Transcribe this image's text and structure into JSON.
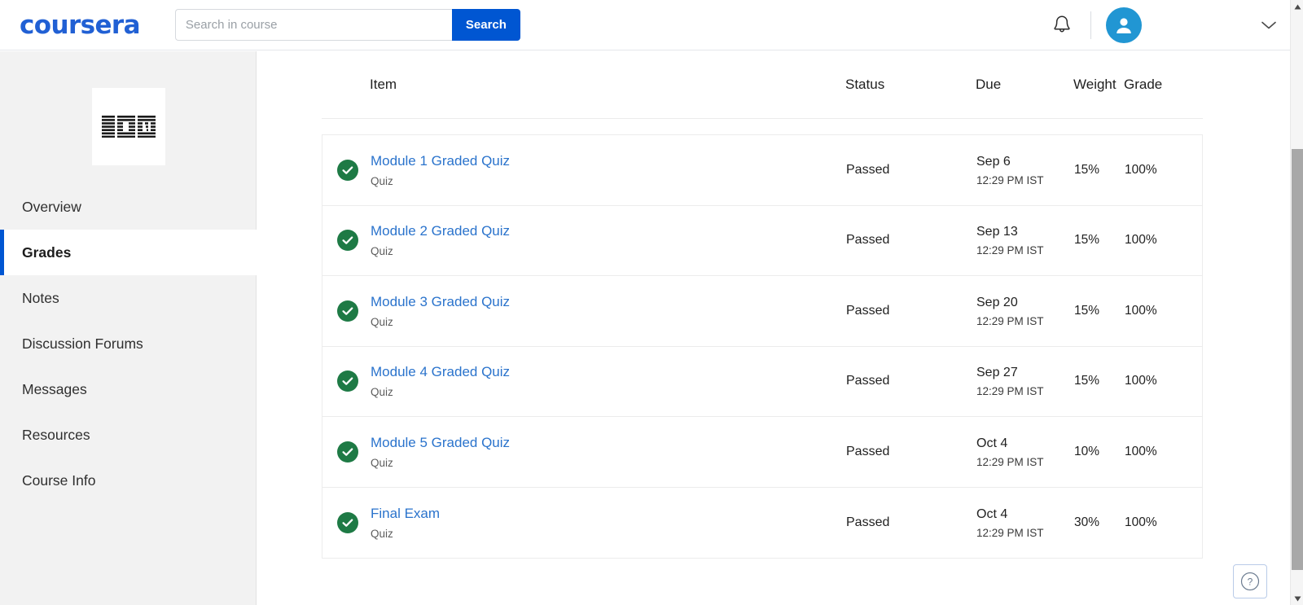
{
  "header": {
    "brand": "coursera",
    "search": {
      "placeholder": "Search in course",
      "value": "",
      "button_label": "Search"
    },
    "notifications_icon": "bell-icon",
    "avatar_icon": "user-avatar-icon",
    "account_chevron_icon": "chevron-down-icon"
  },
  "sidebar": {
    "course_logo_alt": "IBM",
    "items": [
      {
        "label": "Overview",
        "active": false
      },
      {
        "label": "Grades",
        "active": true
      },
      {
        "label": "Notes",
        "active": false
      },
      {
        "label": "Discussion Forums",
        "active": false
      },
      {
        "label": "Messages",
        "active": false
      },
      {
        "label": "Resources",
        "active": false
      },
      {
        "label": "Course Info",
        "active": false
      }
    ]
  },
  "grades": {
    "columns": {
      "item": "Item",
      "status": "Status",
      "due": "Due",
      "weight": "Weight",
      "grade": "Grade"
    },
    "rows": [
      {
        "status_icon": "check-circle-icon",
        "title": "Module 1 Graded Quiz",
        "type": "Quiz",
        "status": "Passed",
        "due_date": "Sep 6",
        "due_time": "12:29 PM IST",
        "weight": "15%",
        "grade": "100%"
      },
      {
        "status_icon": "check-circle-icon",
        "title": "Module 2 Graded Quiz",
        "type": "Quiz",
        "status": "Passed",
        "due_date": "Sep 13",
        "due_time": "12:29 PM IST",
        "weight": "15%",
        "grade": "100%"
      },
      {
        "status_icon": "check-circle-icon",
        "title": "Module 3 Graded Quiz",
        "type": "Quiz",
        "status": "Passed",
        "due_date": "Sep 20",
        "due_time": "12:29 PM IST",
        "weight": "15%",
        "grade": "100%"
      },
      {
        "status_icon": "check-circle-icon",
        "title": "Module 4 Graded Quiz",
        "type": "Quiz",
        "status": "Passed",
        "due_date": "Sep 27",
        "due_time": "12:29 PM IST",
        "weight": "15%",
        "grade": "100%"
      },
      {
        "status_icon": "check-circle-icon",
        "title": "Module 5 Graded Quiz",
        "type": "Quiz",
        "status": "Passed",
        "due_date": "Oct 4",
        "due_time": "12:29 PM IST",
        "weight": "10%",
        "grade": "100%"
      },
      {
        "status_icon": "check-circle-icon",
        "title": "Final Exam",
        "type": "Quiz",
        "status": "Passed",
        "due_date": "Oct 4",
        "due_time": "12:29 PM IST",
        "weight": "30%",
        "grade": "100%"
      }
    ]
  },
  "help": {
    "icon": "question-mark-icon",
    "label": "?"
  },
  "scrollbar": {
    "up_icon": "scroll-up-arrow-icon",
    "down_icon": "scroll-down-arrow-icon"
  },
  "colors": {
    "brand_blue": "#2160d4",
    "button_blue": "#0056d2",
    "link_blue": "#2a73cc",
    "pass_green": "#1e7a45",
    "avatar_blue": "#2196d3",
    "sidebar_bg": "#f2f2f2"
  }
}
